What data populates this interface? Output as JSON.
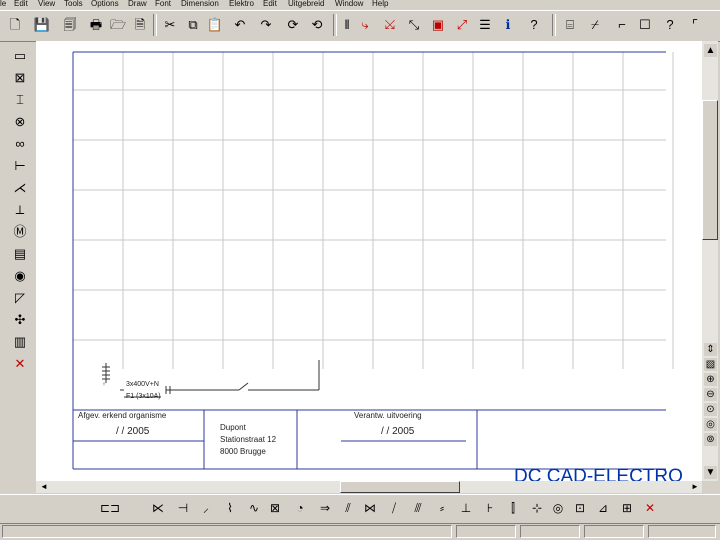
{
  "menu": [
    "le",
    "Edit",
    "View",
    "Tools",
    "Options",
    "Draw",
    "Font",
    "Dimension",
    "Elektro",
    "Edit",
    "Uitgebreid",
    "Window",
    "Help"
  ],
  "circuit": {
    "supply_label": "3x400V+N",
    "breaker_label": "F1 (3x10A)"
  },
  "title_block": {
    "left_header": "Afgev. erkend organisme",
    "left_date": "/ / 2005",
    "address_line1": "Dupont",
    "address_line2": "Stationstraat 12",
    "address_line3": "8000 Brugge",
    "mid_header": "Verantw. uitvoering",
    "mid_date": "/ / 2005",
    "brand": "DC CAD-ELECTRO"
  },
  "colors": {
    "border": "#2b3a9e",
    "grid": "#c8c8c8",
    "brand": "#0033aa",
    "accent_red": "#c00000"
  }
}
